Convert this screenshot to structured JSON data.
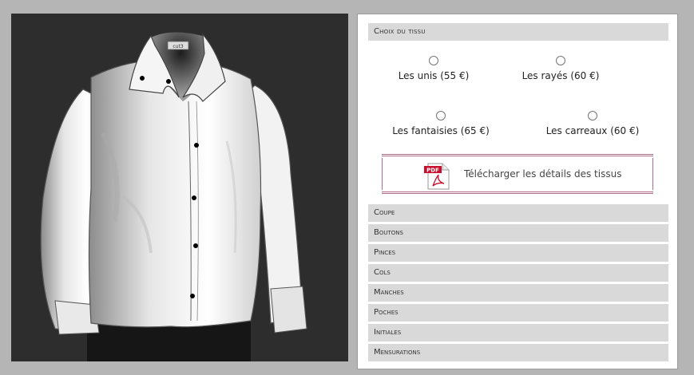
{
  "shirt_image": {
    "label": "cut3"
  },
  "fabric_section": {
    "title": "Choix du tissu",
    "options": [
      {
        "label": "Les unis (55 €)"
      },
      {
        "label": "Les rayés (60 €)"
      },
      {
        "label": "Les fantaisies (65 €)"
      },
      {
        "label": "Les carreaux (60 €)"
      }
    ],
    "download": {
      "icon_text": "PDF",
      "label": "Télécharger les détails des tissus"
    }
  },
  "menu": [
    {
      "label": "Coupe"
    },
    {
      "label": "Boutons"
    },
    {
      "label": "Pinces"
    },
    {
      "label": "Cols"
    },
    {
      "label": "Manches"
    },
    {
      "label": "Poches"
    },
    {
      "label": "Initiales"
    },
    {
      "label": "Mensurations"
    }
  ],
  "colors": {
    "background": "#b5b5b5",
    "preview_bg": "#2d2d2d",
    "header_bg": "#d9d9d9",
    "accent_border": "#b06a8c"
  }
}
